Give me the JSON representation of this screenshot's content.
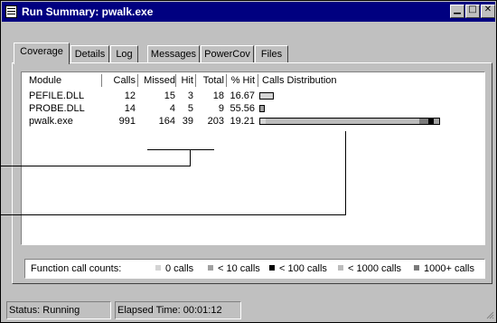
{
  "window": {
    "title": "Run Summary: pwalk.exe",
    "buttons": {
      "minimize": "▁",
      "maximize": "□",
      "close": "✕"
    }
  },
  "tabs": [
    {
      "label": "Coverage",
      "active": true
    },
    {
      "label": "Details",
      "active": false
    },
    {
      "label": "Log",
      "active": false
    },
    {
      "label": "Messages",
      "active": false
    },
    {
      "label": "PowerCov",
      "active": false
    },
    {
      "label": "Files",
      "active": false
    }
  ],
  "table": {
    "columns": [
      "Module",
      "Calls",
      "Missed",
      "Hit",
      "Total",
      "% Hit",
      "Calls Distribution"
    ],
    "rows": [
      {
        "module": "PEFILE.DLL",
        "calls": "12",
        "missed": "15",
        "hit": "3",
        "total": "18",
        "pct": "16.67",
        "distribution": "small"
      },
      {
        "module": "PROBE.DLL",
        "calls": "14",
        "missed": "4",
        "hit": "5",
        "total": "9",
        "pct": "55.56",
        "distribution": "tiny"
      },
      {
        "module": "pwalk.exe",
        "calls": "991",
        "missed": "164",
        "hit": "39",
        "total": "203",
        "pct": "19.21",
        "distribution": "wide"
      }
    ]
  },
  "legend": {
    "label": "Function call counts:",
    "items": [
      {
        "label": "0 calls",
        "color": "#d4d4d4"
      },
      {
        "label": "< 10 calls",
        "color": "#a0a0a0"
      },
      {
        "label": "< 100 calls",
        "color": "#000000"
      },
      {
        "label": "< 1000 calls",
        "color": "#bcbcbc"
      },
      {
        "label": "1000+ calls",
        "color": "#7a7a7a"
      }
    ]
  },
  "status": {
    "state": "Status: Running",
    "elapsed": "Elapsed Time: 00:01:12"
  }
}
